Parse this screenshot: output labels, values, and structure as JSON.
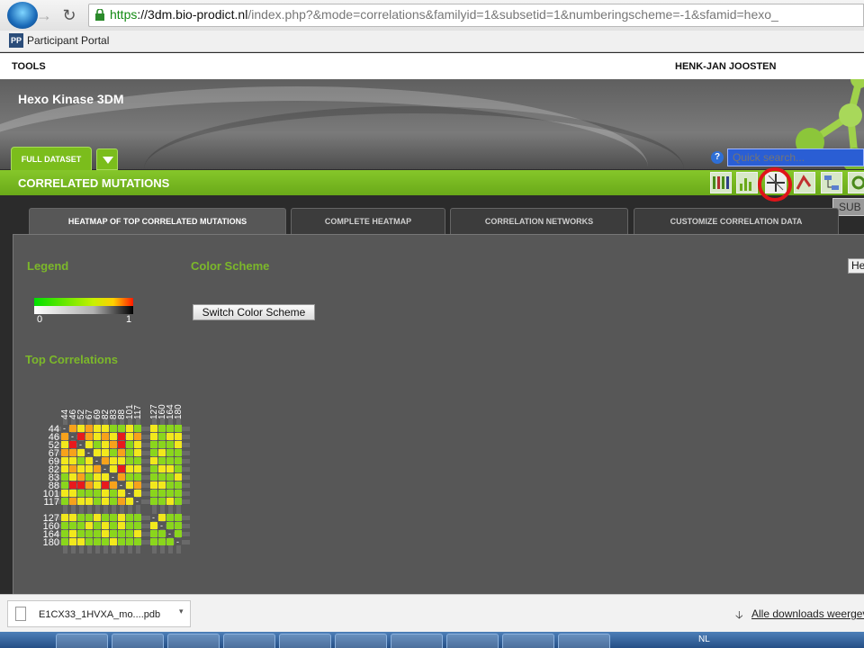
{
  "browser": {
    "url_https": "https",
    "url_host": "://3dm.bio-prodict.nl",
    "url_rest": "/index.php?&mode=correlations&familyid=1&subsetid=1&numberingscheme=-1&sfamid=hexo_",
    "bookmark_label": "Participant Portal",
    "bookmark_icon_text": "PP"
  },
  "app": {
    "tools_label": "TOOLS",
    "user_label": "HENK-JAN JOOSTEN",
    "title": "Hexo Kinase 3DM",
    "dataset_tab": "FULL DATASET",
    "help_glyph": "?",
    "quick_search_placeholder": "Quick search...",
    "section_title": "CORRELATED MUTATIONS",
    "tooltip_text": "SUB",
    "help_button_partial": "He"
  },
  "tabs": [
    "HEATMAP OF TOP CORRELATED MUTATIONS",
    "COMPLETE HEATMAP",
    "CORRELATION NETWORKS",
    "CUSTOMIZE CORRELATION DATA"
  ],
  "legend": {
    "title": "Legend",
    "min": "0",
    "max": "1"
  },
  "color_scheme": {
    "title": "Color Scheme",
    "button": "Switch Color Scheme"
  },
  "top_correlations": {
    "title": "Top Correlations",
    "groups": [
      [
        "44",
        "46",
        "52",
        "67",
        "69",
        "82",
        "83",
        "88",
        "101",
        "117"
      ],
      [
        "127",
        "160",
        "164",
        "180"
      ]
    ],
    "cells": [
      [
        "-",
        "o",
        "y",
        "o",
        "y",
        "y",
        "g",
        "g",
        "y",
        "g",
        "y",
        "g",
        "g",
        "g"
      ],
      [
        "o",
        "-",
        "r",
        "o",
        "y",
        "o",
        "y",
        "r",
        "y",
        "o",
        "y",
        "g",
        "y",
        "y"
      ],
      [
        "y",
        "r",
        "-",
        "y",
        "g",
        "y",
        "o",
        "r",
        "g",
        "y",
        "g",
        "g",
        "g",
        "y"
      ],
      [
        "o",
        "o",
        "y",
        "-",
        "y",
        "y",
        "g",
        "o",
        "g",
        "y",
        "g",
        "y",
        "g",
        "g"
      ],
      [
        "y",
        "y",
        "g",
        "y",
        "-",
        "o",
        "y",
        "y",
        "g",
        "g",
        "y",
        "g",
        "g",
        "g"
      ],
      [
        "y",
        "o",
        "y",
        "y",
        "o",
        "-",
        "y",
        "r",
        "y",
        "y",
        "g",
        "y",
        "y",
        "g"
      ],
      [
        "g",
        "y",
        "o",
        "g",
        "y",
        "y",
        "-",
        "o",
        "g",
        "g",
        "g",
        "g",
        "g",
        "y"
      ],
      [
        "g",
        "r",
        "r",
        "o",
        "y",
        "r",
        "o",
        "-",
        "y",
        "o",
        "y",
        "y",
        "g",
        "g"
      ],
      [
        "y",
        "y",
        "g",
        "g",
        "g",
        "y",
        "g",
        "y",
        "-",
        "y",
        "g",
        "g",
        "g",
        "g"
      ],
      [
        "g",
        "o",
        "y",
        "y",
        "g",
        "y",
        "g",
        "o",
        "y",
        "-",
        "g",
        "g",
        "y",
        "g"
      ],
      [
        "y",
        "y",
        "g",
        "g",
        "y",
        "g",
        "g",
        "y",
        "g",
        "g",
        "-",
        "y",
        "g",
        "g"
      ],
      [
        "g",
        "g",
        "g",
        "y",
        "g",
        "y",
        "g",
        "y",
        "g",
        "g",
        "y",
        "-",
        "g",
        "g"
      ],
      [
        "g",
        "y",
        "g",
        "g",
        "g",
        "y",
        "g",
        "g",
        "g",
        "y",
        "g",
        "g",
        "-",
        "g"
      ],
      [
        "g",
        "y",
        "y",
        "g",
        "g",
        "g",
        "y",
        "g",
        "g",
        "g",
        "g",
        "g",
        "g",
        "-"
      ]
    ],
    "palette": {
      "r": "#e8191c",
      "o": "#f7a21b",
      "y": "#f2e81c",
      "g": "#8ad61c"
    }
  },
  "downloads": {
    "file_name": "E1CX33_1HVXA_mo....pdb",
    "show_all": "Alle downloads weergev"
  },
  "taskbar": {
    "language": "NL"
  },
  "colors": {
    "accent_green": "#7bbd1c",
    "highlight_red": "#e0141a",
    "search_blue": "#2a5ed4"
  }
}
